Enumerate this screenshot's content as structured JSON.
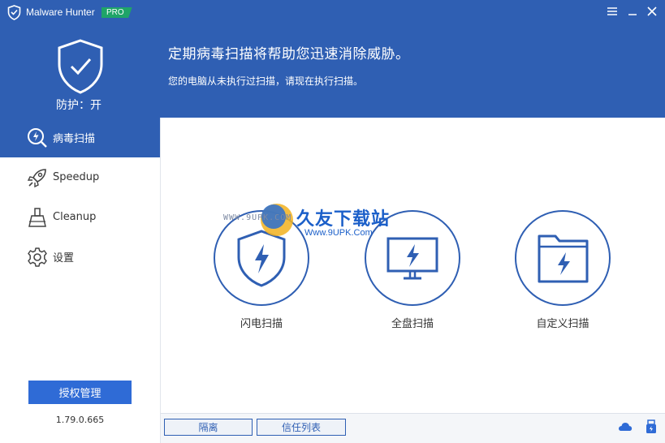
{
  "app": {
    "name": "Malware Hunter",
    "badge": "PRO"
  },
  "header": {
    "protection_status": "防护：开",
    "headline": "定期病毒扫描将帮助您迅速消除威胁。",
    "subline": "您的电脑从未执行过扫描，请现在执行扫描。"
  },
  "sidebar": {
    "items": [
      {
        "label": "病毒扫描",
        "icon": "lightning-search-icon",
        "active": true
      },
      {
        "label": "Speedup",
        "icon": "rocket-icon",
        "active": false
      },
      {
        "label": "Cleanup",
        "icon": "broom-icon",
        "active": false
      },
      {
        "label": "设置",
        "icon": "gear-icon",
        "active": false
      }
    ],
    "license_button": "授权管理",
    "version": "1.79.0.665"
  },
  "scan_options": [
    {
      "label": "闪电扫描",
      "icon": "lightning-shield-icon"
    },
    {
      "label": "全盘扫描",
      "icon": "lightning-monitor-icon"
    },
    {
      "label": "自定义扫描",
      "icon": "lightning-folder-icon"
    }
  ],
  "watermark": {
    "title": "久友下载站",
    "url_top": "WWW.9UPK.COM",
    "url_bottom": "Www.9UPK.Com"
  },
  "bottom_bar": {
    "quarantine": "隔离",
    "trust_list": "信任列表",
    "icons": [
      "cloud-icon",
      "usb-icon"
    ]
  },
  "colors": {
    "header_blue": "#2f5fb3",
    "accent_blue": "#2f6bd6",
    "pro_green": "#1fa468"
  }
}
